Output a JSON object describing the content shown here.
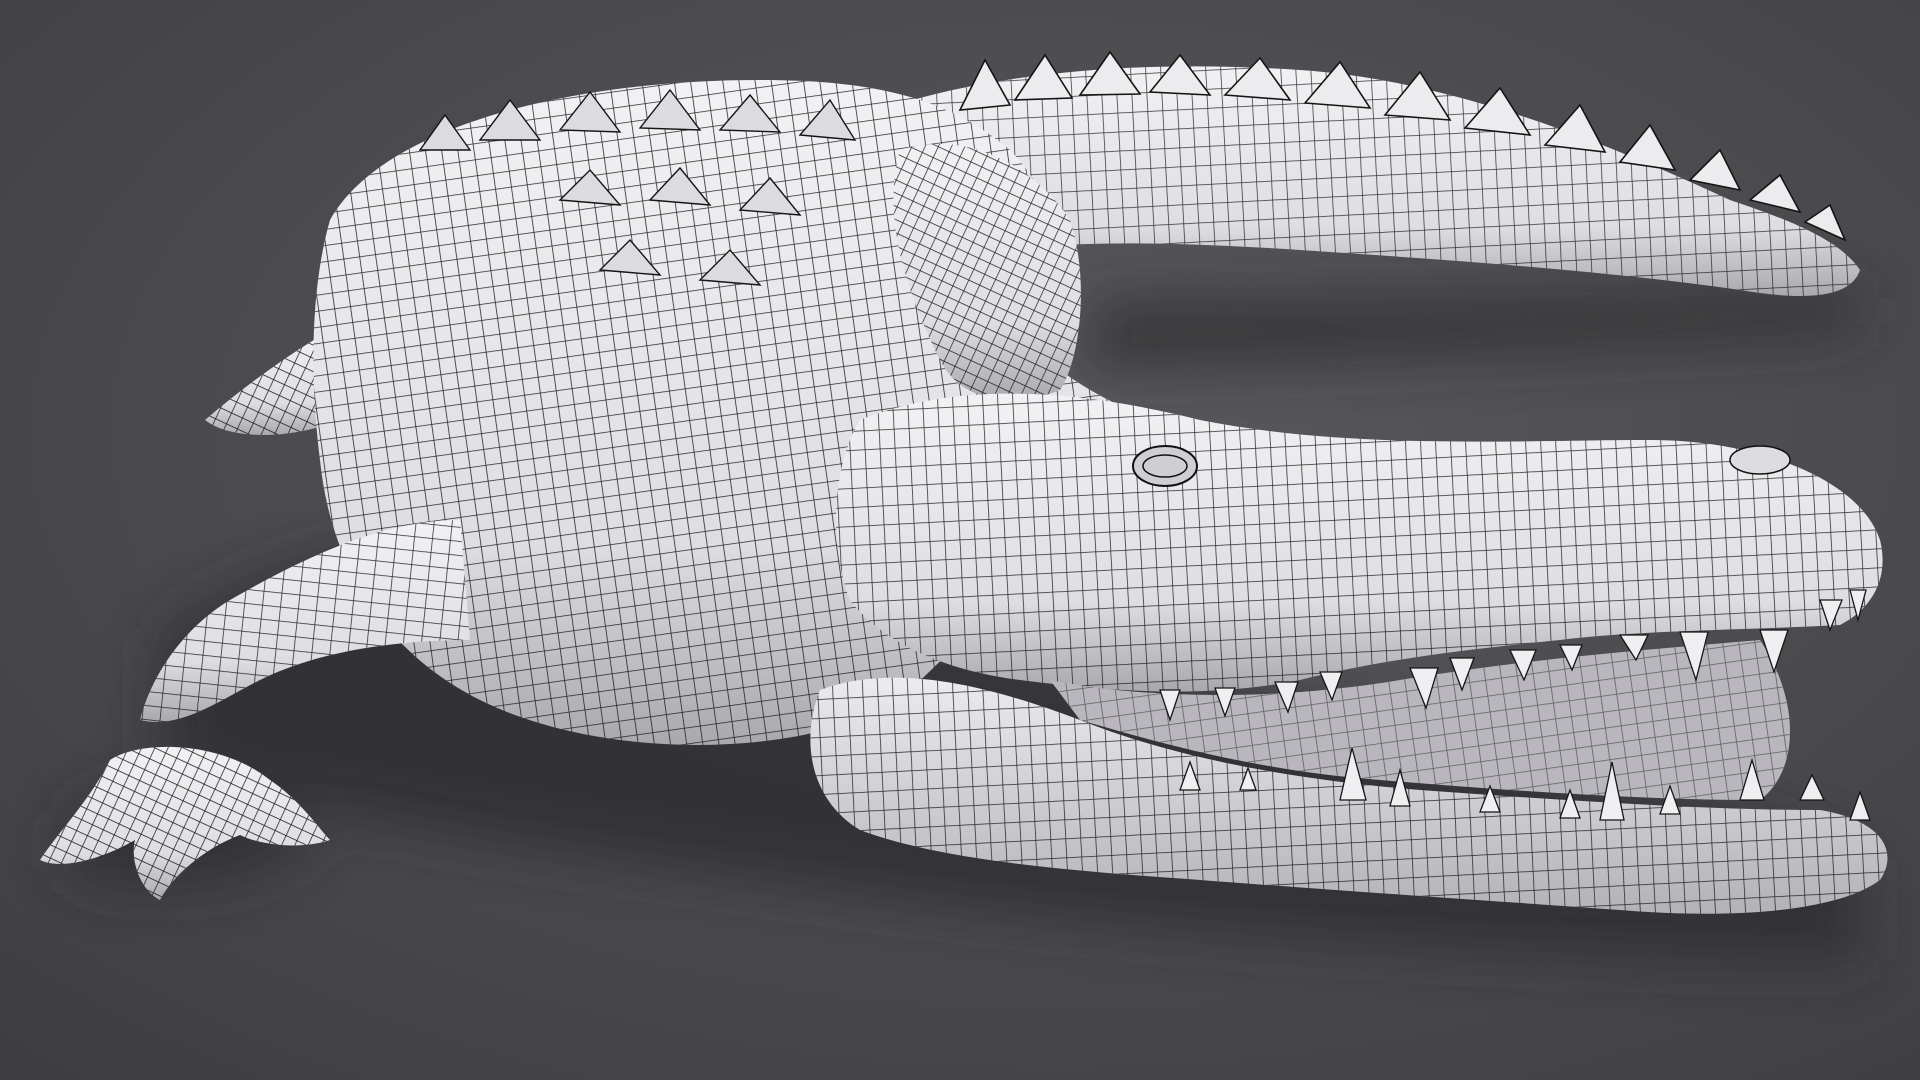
{
  "scene": {
    "subject": "crocodile-wireframe-render",
    "colors": {
      "background_light": "#5a5a5e",
      "background_dark": "#3e3e41",
      "shadow": "#2e2e31",
      "mesh_fill": "#e8e7ea",
      "mesh_fill_shade": "#bdbcc1",
      "wire": "#111111",
      "tooth": "#efeef1",
      "mouth_inside": "#b9b7bd"
    }
  }
}
